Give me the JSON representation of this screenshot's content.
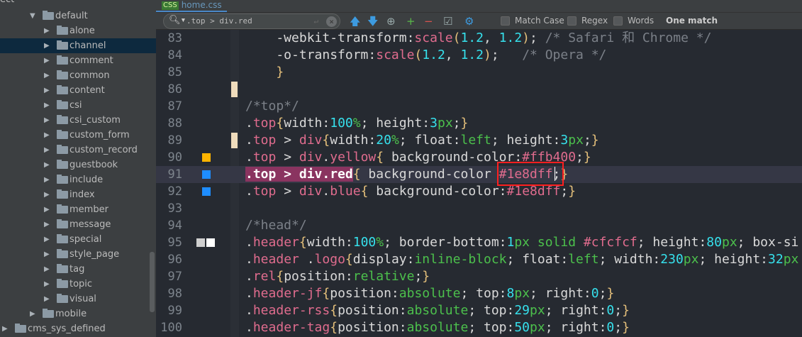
{
  "sidebar": {
    "header_partial": "ect",
    "selected": "channel",
    "items": [
      {
        "label": "default",
        "level": 1,
        "expanded": true
      },
      {
        "label": "alone",
        "level": 2
      },
      {
        "label": "channel",
        "level": 2
      },
      {
        "label": "comment",
        "level": 2
      },
      {
        "label": "common",
        "level": 2
      },
      {
        "label": "content",
        "level": 2
      },
      {
        "label": "csi",
        "level": 2
      },
      {
        "label": "csi_custom",
        "level": 2
      },
      {
        "label": "custom_form",
        "level": 2
      },
      {
        "label": "custom_record",
        "level": 2
      },
      {
        "label": "guestbook",
        "level": 2
      },
      {
        "label": "include",
        "level": 2
      },
      {
        "label": "index",
        "level": 2
      },
      {
        "label": "member",
        "level": 2
      },
      {
        "label": "message",
        "level": 2
      },
      {
        "label": "special",
        "level": 2
      },
      {
        "label": "style_page",
        "level": 2
      },
      {
        "label": "tag",
        "level": 2
      },
      {
        "label": "topic",
        "level": 2
      },
      {
        "label": "visual",
        "level": 2
      },
      {
        "label": "mobile",
        "level": 1
      },
      {
        "label": "cms_sys_defined",
        "level": 0
      }
    ]
  },
  "tab": {
    "badge": "CSS",
    "label": "home.css"
  },
  "find": {
    "search_icon": "search-icon",
    "query": ".top > div.red",
    "enter_icon": "↵",
    "clear_icon": "×",
    "tools": [
      {
        "name": "previous-occurrence",
        "glyph": "🡅",
        "color": "#3d9be0"
      },
      {
        "name": "next-occurrence",
        "glyph": "🡇",
        "color": "#3d9be0"
      },
      {
        "name": "select-all-occurrences",
        "glyph": "⊕",
        "color": "#9aa"
      },
      {
        "name": "add-occurrence",
        "glyph": "+",
        "color": "#59b84a"
      },
      {
        "name": "remove-occurrence",
        "glyph": "−",
        "color": "#d9534f"
      },
      {
        "name": "exclude-occurrence",
        "glyph": "☑",
        "color": "#9aa"
      },
      {
        "name": "settings",
        "glyph": "⚙",
        "color": "#3d9be0"
      }
    ],
    "match_case": "Match Case",
    "regex": "Regex",
    "words": "Words",
    "status": "One match"
  },
  "editor": {
    "current_line": 91,
    "lines": [
      {
        "n": 83,
        "t": [
          [
            "    -webkit-transform:",
            "p"
          ],
          [
            "scale",
            "s"
          ],
          [
            "(",
            "b"
          ],
          [
            "1.2",
            "n"
          ],
          [
            ", ",
            "p"
          ],
          [
            "1.2",
            "n"
          ],
          [
            ")",
            "b"
          ],
          [
            "; ",
            "p"
          ],
          [
            "/* Safari 和 Chrome */",
            "c"
          ]
        ]
      },
      {
        "n": 84,
        "t": [
          [
            "    -o-transform:",
            "p"
          ],
          [
            "scale",
            "s"
          ],
          [
            "(",
            "b"
          ],
          [
            "1.2",
            "n"
          ],
          [
            ", ",
            "p"
          ],
          [
            "1.2",
            "n"
          ],
          [
            ")",
            "b"
          ],
          [
            ";   ",
            "p"
          ],
          [
            "/* Opera */",
            "c"
          ]
        ]
      },
      {
        "n": 85,
        "t": [
          [
            "    ",
            "p"
          ],
          [
            "}",
            "b"
          ]
        ]
      },
      {
        "n": 86,
        "t": [],
        "changed": true
      },
      {
        "n": 87,
        "t": [
          [
            "/*top*/",
            "c"
          ]
        ]
      },
      {
        "n": 88,
        "t": [
          [
            ".",
            "p"
          ],
          [
            "top",
            "s"
          ],
          [
            "{",
            "b"
          ],
          [
            "width:",
            "p"
          ],
          [
            "100",
            "n"
          ],
          [
            "%",
            "k"
          ],
          [
            "; height:",
            "p"
          ],
          [
            "3",
            "n"
          ],
          [
            "px",
            "k"
          ],
          [
            ";",
            "p"
          ],
          [
            "}",
            "b"
          ]
        ]
      },
      {
        "n": 89,
        "t": [
          [
            ".",
            "p"
          ],
          [
            "top",
            "s"
          ],
          [
            " > ",
            "p"
          ],
          [
            "div",
            "s"
          ],
          [
            "{",
            "b"
          ],
          [
            "width:",
            "p"
          ],
          [
            "20",
            "n"
          ],
          [
            "%",
            "k"
          ],
          [
            "; float:",
            "p"
          ],
          [
            "left",
            "k"
          ],
          [
            "; height:",
            "p"
          ],
          [
            "3",
            "n"
          ],
          [
            "px",
            "k"
          ],
          [
            ";",
            "p"
          ],
          [
            "}",
            "b"
          ]
        ],
        "changed": true
      },
      {
        "n": 90,
        "t": [
          [
            ".",
            "p"
          ],
          [
            "top",
            "s"
          ],
          [
            " > ",
            "p"
          ],
          [
            "div",
            "s"
          ],
          [
            ".",
            "p"
          ],
          [
            "yellow",
            "s"
          ],
          [
            "{",
            "b"
          ],
          [
            " background-color:",
            "p"
          ],
          [
            "#ffb400",
            "h"
          ],
          [
            ";",
            "p"
          ],
          [
            "}",
            "b"
          ]
        ],
        "swatch": [
          "#ffb400"
        ]
      },
      {
        "n": 91,
        "t": [
          [
            ".top > div.red",
            "sel"
          ],
          [
            "{",
            "b"
          ],
          [
            " background-color ",
            "p"
          ],
          [
            "#1e8dff",
            "h"
          ],
          [
            ";",
            "p"
          ],
          [
            "}",
            "b"
          ]
        ],
        "swatch": [
          "#1e8dff"
        ]
      },
      {
        "n": 92,
        "t": [
          [
            ".",
            "p"
          ],
          [
            "top",
            "s"
          ],
          [
            " > ",
            "p"
          ],
          [
            "div",
            "s"
          ],
          [
            ".",
            "p"
          ],
          [
            "blue",
            "s"
          ],
          [
            "{",
            "b"
          ],
          [
            " background-color:",
            "p"
          ],
          [
            "#1e8dff",
            "h"
          ],
          [
            ";",
            "p"
          ],
          [
            "}",
            "b"
          ]
        ],
        "swatch": [
          "#1e8dff"
        ]
      },
      {
        "n": 93,
        "t": []
      },
      {
        "n": 94,
        "t": [
          [
            "/*head*/",
            "c"
          ]
        ]
      },
      {
        "n": 95,
        "t": [
          [
            ".",
            "p"
          ],
          [
            "header",
            "s"
          ],
          [
            "{",
            "b"
          ],
          [
            "width:",
            "p"
          ],
          [
            "100",
            "n"
          ],
          [
            "%",
            "k"
          ],
          [
            "; border-bottom:",
            "p"
          ],
          [
            "1",
            "n"
          ],
          [
            "px solid ",
            "k"
          ],
          [
            "#cfcfcf",
            "h"
          ],
          [
            "; height:",
            "p"
          ],
          [
            "80",
            "n"
          ],
          [
            "px",
            "k"
          ],
          [
            "; box-si",
            "p"
          ]
        ],
        "swatch": [
          "#cfcfcf",
          "#ffffff"
        ]
      },
      {
        "n": 96,
        "t": [
          [
            ".",
            "p"
          ],
          [
            "header",
            "s"
          ],
          [
            " .",
            "p"
          ],
          [
            "logo",
            "s"
          ],
          [
            "{",
            "b"
          ],
          [
            "display:",
            "p"
          ],
          [
            "inline-block",
            "k"
          ],
          [
            "; float:",
            "p"
          ],
          [
            "left",
            "k"
          ],
          [
            "; width:",
            "p"
          ],
          [
            "230",
            "n"
          ],
          [
            "px",
            "k"
          ],
          [
            "; height:",
            "p"
          ],
          [
            "32",
            "n"
          ],
          [
            "px",
            "k"
          ]
        ]
      },
      {
        "n": 97,
        "t": [
          [
            ".",
            "p"
          ],
          [
            "rel",
            "s"
          ],
          [
            "{",
            "b"
          ],
          [
            "position:",
            "p"
          ],
          [
            "relative",
            "k"
          ],
          [
            ";",
            "p"
          ],
          [
            "}",
            "b"
          ]
        ]
      },
      {
        "n": 98,
        "t": [
          [
            ".",
            "p"
          ],
          [
            "header-jf",
            "s"
          ],
          [
            "{",
            "b"
          ],
          [
            "position:",
            "p"
          ],
          [
            "absolute",
            "k"
          ],
          [
            "; top:",
            "p"
          ],
          [
            "8",
            "n"
          ],
          [
            "px",
            "k"
          ],
          [
            "; right:",
            "p"
          ],
          [
            "0",
            "n"
          ],
          [
            ";",
            "p"
          ],
          [
            "}",
            "b"
          ]
        ]
      },
      {
        "n": 99,
        "t": [
          [
            ".",
            "p"
          ],
          [
            "header-rss",
            "s"
          ],
          [
            "{",
            "b"
          ],
          [
            "position:",
            "p"
          ],
          [
            "absolute",
            "k"
          ],
          [
            "; top:",
            "p"
          ],
          [
            "29",
            "n"
          ],
          [
            "px",
            "k"
          ],
          [
            "; right:",
            "p"
          ],
          [
            "0",
            "n"
          ],
          [
            ";",
            "p"
          ],
          [
            "}",
            "b"
          ]
        ]
      },
      {
        "n": 100,
        "t": [
          [
            ".",
            "p"
          ],
          [
            "header-tag",
            "s"
          ],
          [
            "{",
            "b"
          ],
          [
            "position:",
            "p"
          ],
          [
            "absolute",
            "k"
          ],
          [
            "; top:",
            "p"
          ],
          [
            "50",
            "n"
          ],
          [
            "px",
            "k"
          ],
          [
            "; right:",
            "p"
          ],
          [
            "0",
            "n"
          ],
          [
            ";",
            "p"
          ],
          [
            "}",
            "b"
          ]
        ]
      }
    ]
  }
}
